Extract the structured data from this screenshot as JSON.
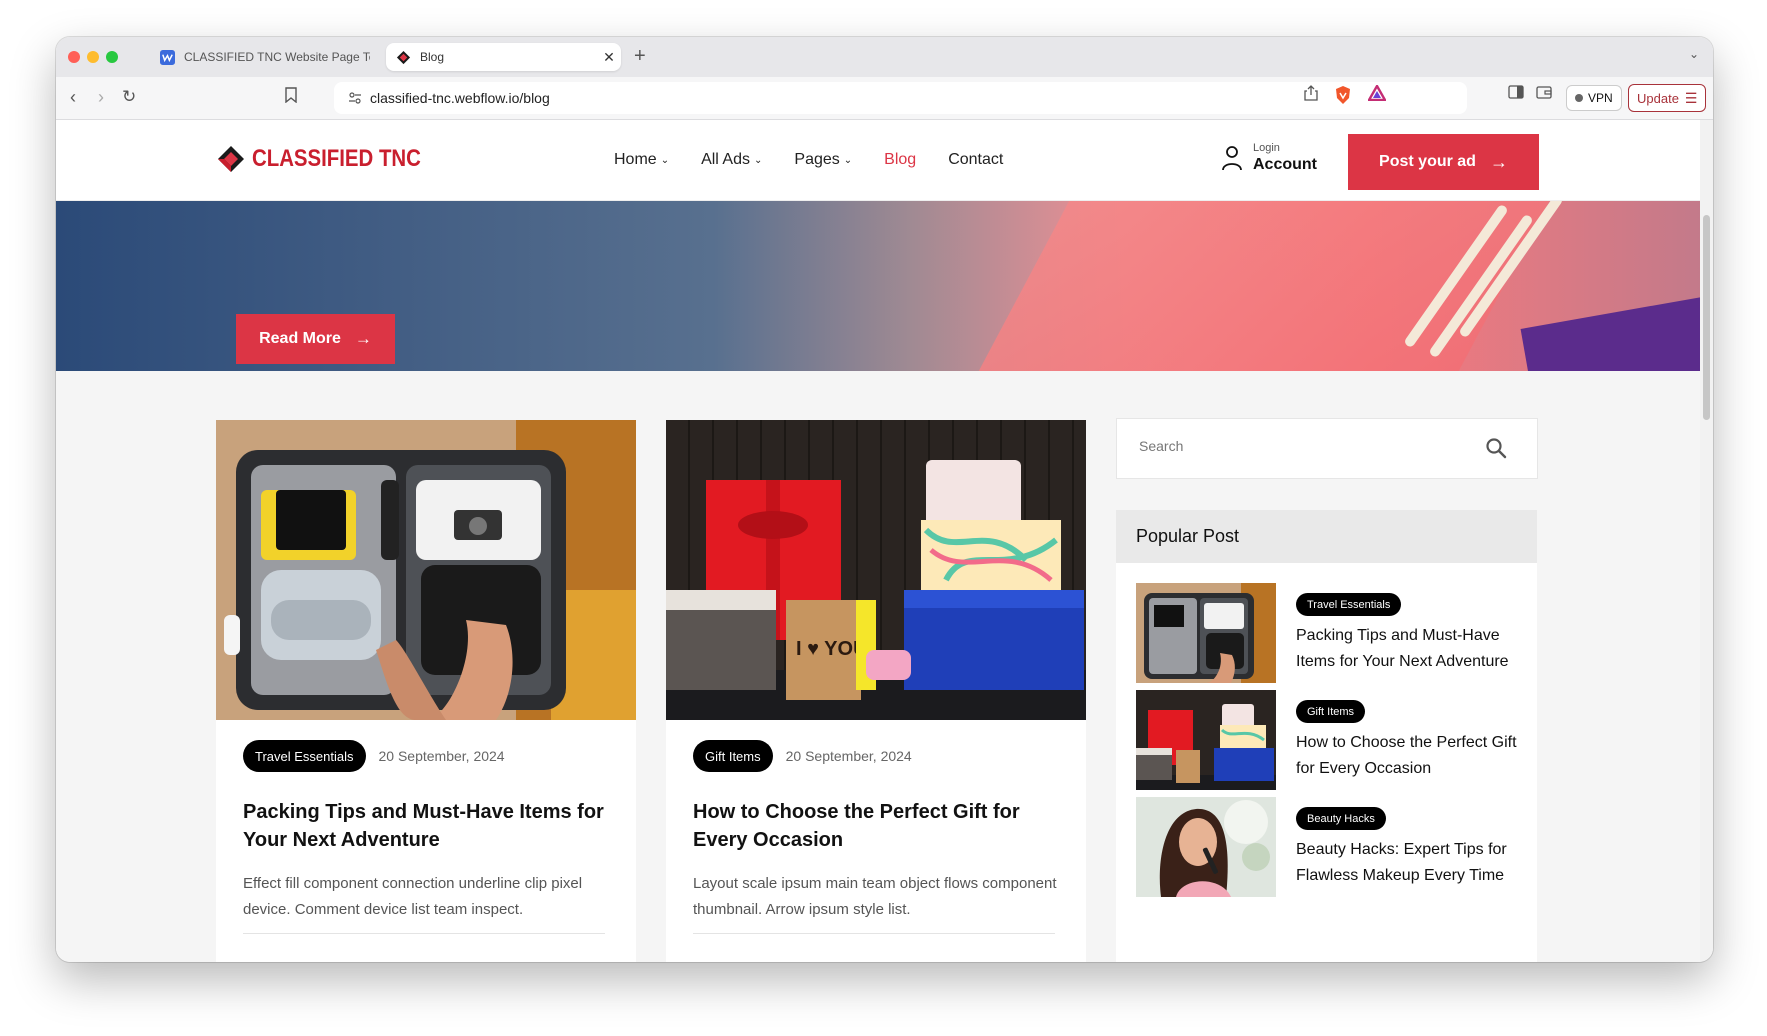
{
  "browser": {
    "tabs": [
      {
        "label": "CLASSIFIED TNC Website Page Tem",
        "active": false
      },
      {
        "label": "Blog",
        "active": true
      }
    ],
    "url": "classified-tnc.webflow.io/blog",
    "vpn_label": "VPN",
    "update_label": "Update"
  },
  "header": {
    "logo_text": "CLASSIFIED TNC",
    "nav": [
      {
        "label": "Home",
        "dropdown": true
      },
      {
        "label": "All Ads",
        "dropdown": true
      },
      {
        "label": "Pages",
        "dropdown": true
      },
      {
        "label": "Blog",
        "dropdown": false,
        "active": true
      },
      {
        "label": "Contact",
        "dropdown": false
      }
    ],
    "account_small": "Login",
    "account_big": "Account",
    "post_ad_label": "Post your ad"
  },
  "hero": {
    "read_more_label": "Read More"
  },
  "posts": [
    {
      "category": "Travel Essentials",
      "date": "20 September, 2024",
      "title": "Packing Tips and Must-Have Items for Your Next Adventure",
      "excerpt": "Effect fill component connection underline clip pixel device. Comment device list team inspect."
    },
    {
      "category": "Gift Items",
      "date": "20 September, 2024",
      "title": "How to Choose the Perfect Gift for Every Occasion",
      "excerpt": "Layout scale ipsum main team object flows component thumbnail. Arrow ipsum style list."
    }
  ],
  "sidebar": {
    "search_placeholder": "Search",
    "popular_title": "Popular Post",
    "popular": [
      {
        "category": "Travel Essentials",
        "title": "Packing Tips and Must-Have Items for Your Next Adventure"
      },
      {
        "category": "Gift Items",
        "title": "How to Choose the Perfect Gift for Every Occasion"
      },
      {
        "category": "Beauty Hacks",
        "title": "Beauty Hacks: Expert Tips for Flawless Makeup Every Time"
      }
    ]
  },
  "colors": {
    "accent": "#dc3545",
    "logo": "#c91f2e"
  }
}
